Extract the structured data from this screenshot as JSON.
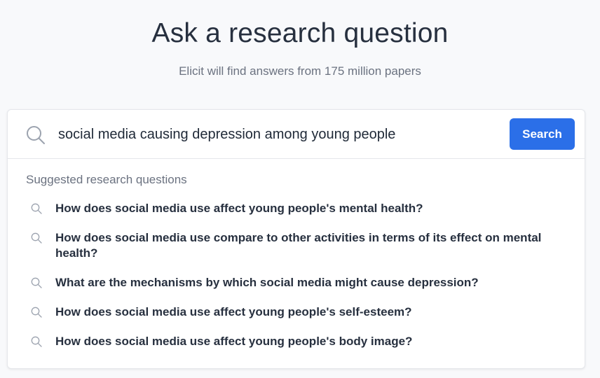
{
  "header": {
    "title": "Ask a research question",
    "subtitle": "Elicit will find answers from 175 million papers"
  },
  "search": {
    "value": "social media causing depression among young people",
    "icon": "search-icon",
    "button_label": "Search",
    "button_color": "#2b6fe8"
  },
  "suggestions": {
    "heading": "Suggested research questions",
    "icon": "search-icon",
    "items": [
      "How does social media use affect young people's mental health?",
      "How does social media use compare to other activities in terms of its effect on mental health?",
      "What are the mechanisms by which social media might cause depression?",
      "How does social media use affect young people's self-esteem?",
      "How does social media use affect young people's body image?"
    ]
  }
}
